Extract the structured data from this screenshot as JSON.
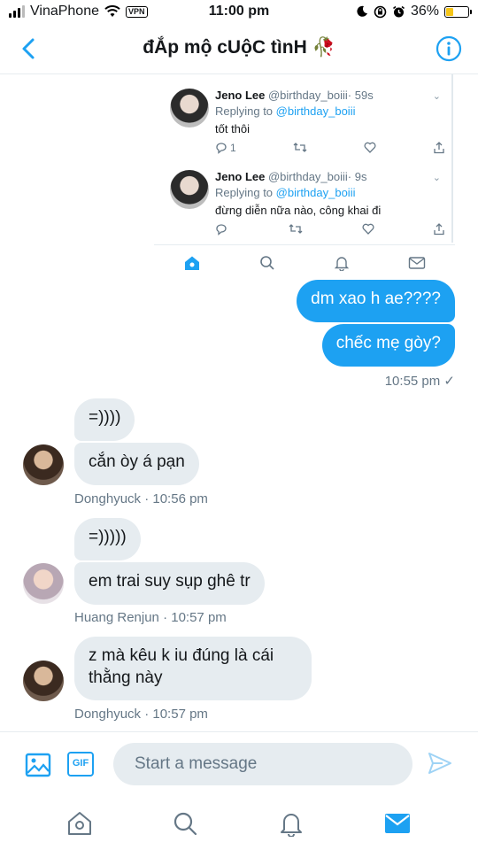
{
  "status": {
    "carrier": "VinaPhone",
    "vpn": "VPN",
    "time": "11:00 pm",
    "battery": "36%",
    "battery_level": 0.36
  },
  "header": {
    "title": "đẮp mộ cUộC tìnH 🥀"
  },
  "embed": {
    "tweets": [
      {
        "name": "Jeno Lee",
        "handle": "@birthday_boiii",
        "age": "· 59s",
        "replying_prefix": "Replying to",
        "replying_to": "@birthday_boiii",
        "text": "tốt thôi",
        "reply_count": "1"
      },
      {
        "name": "Jeno Lee",
        "handle": "@birthday_boiii",
        "age": "· 9s",
        "replying_prefix": "Replying to",
        "replying_to": "@birthday_boiii",
        "text": "đừng diễn nữa nào, công khai đi",
        "reply_count": ""
      }
    ]
  },
  "messages": {
    "out1": "dm xao h ae????",
    "out2": "chếc mẹ gòy?",
    "out_time": "10:55 pm ✓",
    "d1a": "=))))",
    "d1b": "cắn òy á pạn",
    "d1_meta": "Donghyuck · 10:56 pm",
    "r1a": "=)))))",
    "r1b": "em trai suy sụp ghê tr",
    "r1_meta": "Huang Renjun · 10:57 pm",
    "d2_line1": "z mà kêu k iu đúng là cái",
    "d2_line2": "thằng này",
    "d2_meta": "Donghyuck · 10:57 pm"
  },
  "compose": {
    "gif_label": "GIF",
    "placeholder": "Start a message"
  },
  "colors": {
    "accent": "#1da1f2",
    "bubble_in": "#e6ecf0",
    "muted": "#657786"
  }
}
